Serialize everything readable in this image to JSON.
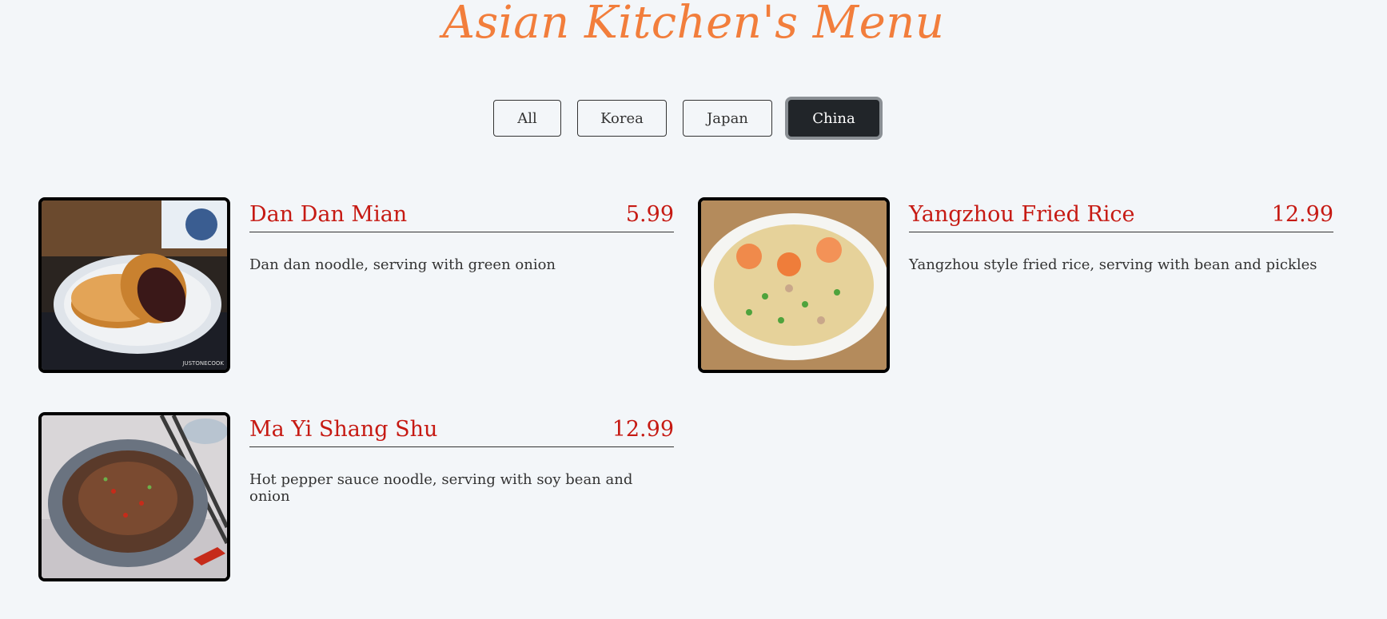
{
  "header": {
    "title": "Asian Kitchen's Menu"
  },
  "filters": [
    {
      "label": "All",
      "active": false
    },
    {
      "label": "Korea",
      "active": false
    },
    {
      "label": "Japan",
      "active": false
    },
    {
      "label": "China",
      "active": true
    }
  ],
  "menu": {
    "items": [
      {
        "name": "Dan Dan Mian",
        "price": "5.99",
        "description": "Dan dan noodle, serving with green onion",
        "image_watermark": "JUSTONECOOK"
      },
      {
        "name": "Yangzhou Fried Rice",
        "price": "12.99",
        "description": "Yangzhou style fried rice, serving with bean and pickles"
      },
      {
        "name": "Ma Yi Shang Shu",
        "price": "12.99",
        "description": "Hot pepper sauce noodle, serving with soy bean and onion"
      }
    ]
  },
  "colors": {
    "background": "#f3f6f9",
    "title": "#f27e3c",
    "item_text": "#c61a13",
    "active_button": "#212529"
  }
}
